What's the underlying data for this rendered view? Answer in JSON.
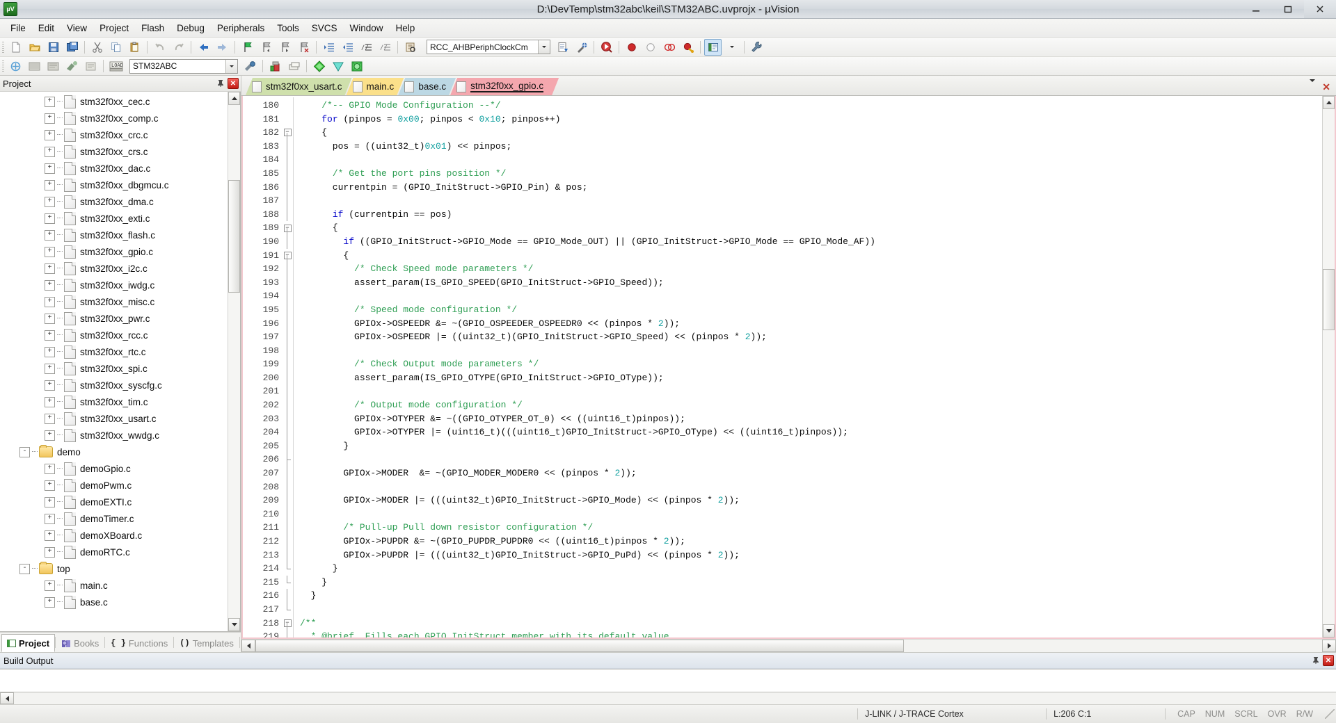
{
  "window": {
    "title": "D:\\DevTemp\\stm32abc\\keil\\STM32ABC.uvprojx - µVision",
    "app_icon": "uvision-icon",
    "minimize": "minimize-button",
    "maximize": "maximize-button",
    "close": "close-button"
  },
  "menu": {
    "items": [
      "File",
      "Edit",
      "View",
      "Project",
      "Flash",
      "Debug",
      "Peripherals",
      "Tools",
      "SVCS",
      "Window",
      "Help"
    ]
  },
  "toolbar1": {
    "icons": [
      "new-file-icon",
      "open-file-icon",
      "save-icon",
      "save-all-icon",
      "cut-icon",
      "copy-icon",
      "paste-icon",
      "undo-icon",
      "redo-icon",
      "navigate-back-icon",
      "navigate-forward-icon",
      "bookmark-toggle-icon",
      "bookmark-prev-icon",
      "bookmark-next-icon",
      "bookmark-clear-icon",
      "indent-right-icon",
      "indent-left-icon",
      "comment-lines-icon",
      "uncomment-lines-icon",
      "find-in-files-icon"
    ],
    "symbol_combo_value": "RCC_AHBPeriphClockCm",
    "after_combo_icons": [
      "insert-template-icon",
      "configuration-wizard-icon",
      "start-debug-icon",
      "breakpoint-icon",
      "breakpoint-disable-icon",
      "breakpoints-kill-all-icon",
      "breakpoint-enable-icon",
      "project-window-icon",
      "project-window-dropdown-icon",
      "options-wrench-icon"
    ]
  },
  "toolbar2": {
    "icons": [
      "translate-file-icon",
      "build-target-icon",
      "rebuild-all-icon",
      "batch-build-icon",
      "stop-build-icon",
      "download-icon"
    ],
    "target_combo_value": "STM32ABC",
    "after_icons": [
      "target-options-icon",
      "manage-project-items-icon",
      "manage-multi-project-icon",
      "pack-installer-icon",
      "manage-run-time-env-icon",
      "software-packs-icon"
    ]
  },
  "project_pane": {
    "title": "Project",
    "pin_icon": "pin-icon",
    "close_icon": "close-icon",
    "tree": [
      {
        "label": "stm32f0xx_cec.c",
        "type": "file",
        "depth": 2,
        "expander": "+"
      },
      {
        "label": "stm32f0xx_comp.c",
        "type": "file",
        "depth": 2,
        "expander": "+"
      },
      {
        "label": "stm32f0xx_crc.c",
        "type": "file",
        "depth": 2,
        "expander": "+"
      },
      {
        "label": "stm32f0xx_crs.c",
        "type": "file",
        "depth": 2,
        "expander": "+"
      },
      {
        "label": "stm32f0xx_dac.c",
        "type": "file",
        "depth": 2,
        "expander": "+"
      },
      {
        "label": "stm32f0xx_dbgmcu.c",
        "type": "file",
        "depth": 2,
        "expander": "+"
      },
      {
        "label": "stm32f0xx_dma.c",
        "type": "file",
        "depth": 2,
        "expander": "+"
      },
      {
        "label": "stm32f0xx_exti.c",
        "type": "file",
        "depth": 2,
        "expander": "+"
      },
      {
        "label": "stm32f0xx_flash.c",
        "type": "file",
        "depth": 2,
        "expander": "+"
      },
      {
        "label": "stm32f0xx_gpio.c",
        "type": "file",
        "depth": 2,
        "expander": "+"
      },
      {
        "label": "stm32f0xx_i2c.c",
        "type": "file",
        "depth": 2,
        "expander": "+"
      },
      {
        "label": "stm32f0xx_iwdg.c",
        "type": "file",
        "depth": 2,
        "expander": "+"
      },
      {
        "label": "stm32f0xx_misc.c",
        "type": "file",
        "depth": 2,
        "expander": "+"
      },
      {
        "label": "stm32f0xx_pwr.c",
        "type": "file",
        "depth": 2,
        "expander": "+"
      },
      {
        "label": "stm32f0xx_rcc.c",
        "type": "file",
        "depth": 2,
        "expander": "+"
      },
      {
        "label": "stm32f0xx_rtc.c",
        "type": "file",
        "depth": 2,
        "expander": "+"
      },
      {
        "label": "stm32f0xx_spi.c",
        "type": "file",
        "depth": 2,
        "expander": "+"
      },
      {
        "label": "stm32f0xx_syscfg.c",
        "type": "file",
        "depth": 2,
        "expander": "+"
      },
      {
        "label": "stm32f0xx_tim.c",
        "type": "file",
        "depth": 2,
        "expander": "+"
      },
      {
        "label": "stm32f0xx_usart.c",
        "type": "file",
        "depth": 2,
        "expander": "+"
      },
      {
        "label": "stm32f0xx_wwdg.c",
        "type": "file",
        "depth": 2,
        "expander": "+"
      },
      {
        "label": "demo",
        "type": "folder",
        "depth": 1,
        "expander": "-"
      },
      {
        "label": "demoGpio.c",
        "type": "file",
        "depth": 2,
        "expander": "+"
      },
      {
        "label": "demoPwm.c",
        "type": "file",
        "depth": 2,
        "expander": "+"
      },
      {
        "label": "demoEXTI.c",
        "type": "file",
        "depth": 2,
        "expander": "+"
      },
      {
        "label": "demoTimer.c",
        "type": "file",
        "depth": 2,
        "expander": "+"
      },
      {
        "label": "demoXBoard.c",
        "type": "file",
        "depth": 2,
        "expander": "+"
      },
      {
        "label": "demoRTC.c",
        "type": "file",
        "depth": 2,
        "expander": "+"
      },
      {
        "label": "top",
        "type": "folder",
        "depth": 1,
        "expander": "-"
      },
      {
        "label": "main.c",
        "type": "file",
        "depth": 2,
        "expander": "+"
      },
      {
        "label": "base.c",
        "type": "file",
        "depth": 2,
        "expander": "+"
      }
    ],
    "bottom_tabs": [
      {
        "label": "Project",
        "icon": "project-icon",
        "selected": true
      },
      {
        "label": "Books",
        "icon": "books-icon",
        "selected": false
      },
      {
        "label": "Functions",
        "icon": "functions-icon",
        "selected": false
      },
      {
        "label": "Templates",
        "icon": "templates-icon",
        "selected": false
      }
    ]
  },
  "editor": {
    "tabs": [
      {
        "label": "stm32f0xx_usart.c",
        "active": false,
        "color": "#cfe0ac"
      },
      {
        "label": "main.c",
        "active": false,
        "color": "#fbe08a"
      },
      {
        "label": "base.c",
        "active": false,
        "color": "#bcd8e4"
      },
      {
        "label": "stm32f0xx_gpio.c",
        "active": true,
        "color": "#f4a7ae"
      }
    ],
    "tabbar_controls": [
      "tab-list-dropdown-icon",
      "close-document-icon"
    ],
    "first_line_number": 180,
    "lines": [
      {
        "n": 180,
        "fold": "",
        "segs": [
          {
            "t": "    ",
            "c": ""
          },
          {
            "t": "/*-- GPIO Mode Configuration --*/",
            "c": "cmt"
          }
        ]
      },
      {
        "n": 181,
        "fold": "",
        "segs": [
          {
            "t": "    ",
            "c": ""
          },
          {
            "t": "for",
            "c": "kw"
          },
          {
            "t": " (pinpos = ",
            "c": ""
          },
          {
            "t": "0x00",
            "c": "num"
          },
          {
            "t": "; pinpos < ",
            "c": ""
          },
          {
            "t": "0x10",
            "c": "num"
          },
          {
            "t": "; pinpos++)",
            "c": ""
          }
        ]
      },
      {
        "n": 182,
        "fold": "box-minus-start",
        "segs": [
          {
            "t": "    {",
            "c": ""
          }
        ]
      },
      {
        "n": 183,
        "fold": "bar",
        "segs": [
          {
            "t": "      pos = ((uint32_t)",
            "c": ""
          },
          {
            "t": "0x01",
            "c": "num"
          },
          {
            "t": ") << pinpos;",
            "c": ""
          }
        ]
      },
      {
        "n": 184,
        "fold": "bar",
        "segs": [
          {
            "t": "",
            "c": ""
          }
        ]
      },
      {
        "n": 185,
        "fold": "bar",
        "segs": [
          {
            "t": "      ",
            "c": ""
          },
          {
            "t": "/* Get the port pins position */",
            "c": "cmt"
          }
        ]
      },
      {
        "n": 186,
        "fold": "bar",
        "segs": [
          {
            "t": "      currentpin = (GPIO_InitStruct->GPIO_Pin) & pos;",
            "c": ""
          }
        ]
      },
      {
        "n": 187,
        "fold": "bar",
        "segs": [
          {
            "t": "",
            "c": ""
          }
        ]
      },
      {
        "n": 188,
        "fold": "bar",
        "segs": [
          {
            "t": "      ",
            "c": ""
          },
          {
            "t": "if",
            "c": "kw"
          },
          {
            "t": " (currentpin == pos)",
            "c": ""
          }
        ]
      },
      {
        "n": 189,
        "fold": "box-minus",
        "segs": [
          {
            "t": "      {",
            "c": ""
          }
        ]
      },
      {
        "n": 190,
        "fold": "bar",
        "segs": [
          {
            "t": "        ",
            "c": ""
          },
          {
            "t": "if",
            "c": "kw"
          },
          {
            "t": " ((GPIO_InitStruct->GPIO_Mode == GPIO_Mode_OUT) || (GPIO_InitStruct->GPIO_Mode == GPIO_Mode_AF))",
            "c": ""
          }
        ]
      },
      {
        "n": 191,
        "fold": "box-minus",
        "segs": [
          {
            "t": "        {",
            "c": ""
          }
        ]
      },
      {
        "n": 192,
        "fold": "bar",
        "segs": [
          {
            "t": "          ",
            "c": ""
          },
          {
            "t": "/* Check Speed mode parameters */",
            "c": "cmt"
          }
        ]
      },
      {
        "n": 193,
        "fold": "bar",
        "segs": [
          {
            "t": "          assert_param(IS_GPIO_SPEED(GPIO_InitStruct->GPIO_Speed));",
            "c": ""
          }
        ]
      },
      {
        "n": 194,
        "fold": "bar",
        "segs": [
          {
            "t": "",
            "c": ""
          }
        ]
      },
      {
        "n": 195,
        "fold": "bar",
        "segs": [
          {
            "t": "          ",
            "c": ""
          },
          {
            "t": "/* Speed mode configuration */",
            "c": "cmt"
          }
        ]
      },
      {
        "n": 196,
        "fold": "bar",
        "segs": [
          {
            "t": "          GPIOx->OSPEEDR &= ~(GPIO_OSPEEDER_OSPEEDR0 << (pinpos * ",
            "c": ""
          },
          {
            "t": "2",
            "c": "num"
          },
          {
            "t": "));",
            "c": ""
          }
        ]
      },
      {
        "n": 197,
        "fold": "bar",
        "segs": [
          {
            "t": "          GPIOx->OSPEEDR |= ((uint32_t)(GPIO_InitStruct->GPIO_Speed) << (pinpos * ",
            "c": ""
          },
          {
            "t": "2",
            "c": "num"
          },
          {
            "t": "));",
            "c": ""
          }
        ]
      },
      {
        "n": 198,
        "fold": "bar",
        "segs": [
          {
            "t": "",
            "c": ""
          }
        ]
      },
      {
        "n": 199,
        "fold": "bar",
        "segs": [
          {
            "t": "          ",
            "c": ""
          },
          {
            "t": "/* Check Output mode parameters */",
            "c": "cmt"
          }
        ]
      },
      {
        "n": 200,
        "fold": "bar",
        "segs": [
          {
            "t": "          assert_param(IS_GPIO_OTYPE(GPIO_InitStruct->GPIO_OType));",
            "c": ""
          }
        ]
      },
      {
        "n": 201,
        "fold": "bar",
        "segs": [
          {
            "t": "",
            "c": ""
          }
        ]
      },
      {
        "n": 202,
        "fold": "bar",
        "segs": [
          {
            "t": "          ",
            "c": ""
          },
          {
            "t": "/* Output mode configuration */",
            "c": "cmt"
          }
        ]
      },
      {
        "n": 203,
        "fold": "bar",
        "segs": [
          {
            "t": "          GPIOx->OTYPER &= ~((GPIO_OTYPER_OT_0) << ((uint16_t)pinpos));",
            "c": ""
          }
        ]
      },
      {
        "n": 204,
        "fold": "bar",
        "segs": [
          {
            "t": "          GPIOx->OTYPER |= (uint16_t)(((uint16_t)GPIO_InitStruct->GPIO_OType) << ((uint16_t)pinpos));",
            "c": ""
          }
        ]
      },
      {
        "n": 205,
        "fold": "bar",
        "segs": [
          {
            "t": "        }",
            "c": ""
          }
        ]
      },
      {
        "n": 206,
        "fold": "tick",
        "segs": [
          {
            "t": "",
            "c": ""
          }
        ]
      },
      {
        "n": 207,
        "fold": "bar",
        "segs": [
          {
            "t": "        GPIOx->MODER  &= ~(GPIO_MODER_MODER0 << (pinpos * ",
            "c": ""
          },
          {
            "t": "2",
            "c": "num"
          },
          {
            "t": "));",
            "c": ""
          }
        ]
      },
      {
        "n": 208,
        "fold": "bar",
        "segs": [
          {
            "t": "",
            "c": ""
          }
        ]
      },
      {
        "n": 209,
        "fold": "bar",
        "segs": [
          {
            "t": "        GPIOx->MODER |= (((uint32_t)GPIO_InitStruct->GPIO_Mode) << (pinpos * ",
            "c": ""
          },
          {
            "t": "2",
            "c": "num"
          },
          {
            "t": "));",
            "c": ""
          }
        ]
      },
      {
        "n": 210,
        "fold": "bar",
        "segs": [
          {
            "t": "",
            "c": ""
          }
        ]
      },
      {
        "n": 211,
        "fold": "bar",
        "segs": [
          {
            "t": "        ",
            "c": ""
          },
          {
            "t": "/* Pull-up Pull down resistor configuration */",
            "c": "cmt"
          }
        ]
      },
      {
        "n": 212,
        "fold": "bar",
        "segs": [
          {
            "t": "        GPIOx->PUPDR &= ~(GPIO_PUPDR_PUPDR0 << ((uint16_t)pinpos * ",
            "c": ""
          },
          {
            "t": "2",
            "c": "num"
          },
          {
            "t": "));",
            "c": ""
          }
        ]
      },
      {
        "n": 213,
        "fold": "bar",
        "segs": [
          {
            "t": "        GPIOx->PUPDR |= (((uint32_t)GPIO_InitStruct->GPIO_PuPd) << (pinpos * ",
            "c": ""
          },
          {
            "t": "2",
            "c": "num"
          },
          {
            "t": "));",
            "c": ""
          }
        ]
      },
      {
        "n": 214,
        "fold": "end",
        "segs": [
          {
            "t": "      }",
            "c": ""
          }
        ]
      },
      {
        "n": 215,
        "fold": "end",
        "segs": [
          {
            "t": "    }",
            "c": ""
          }
        ]
      },
      {
        "n": 216,
        "fold": "bar",
        "segs": [
          {
            "t": "  }",
            "c": ""
          }
        ]
      },
      {
        "n": 217,
        "fold": "end",
        "segs": [
          {
            "t": "",
            "c": ""
          }
        ]
      },
      {
        "n": 218,
        "fold": "box-minus-start",
        "segs": [
          {
            "t": "/**",
            "c": "cmt"
          }
        ]
      },
      {
        "n": 219,
        "fold": "bar",
        "segs": [
          {
            "t": "  ",
            "c": ""
          },
          {
            "t": "* @brief  Fills each GPIO_InitStruct member with its default value.",
            "c": "cmt"
          }
        ]
      }
    ]
  },
  "build_output": {
    "title": "Build Output",
    "pin_icon": "pin-icon",
    "close_icon": "close-icon",
    "text": ""
  },
  "statusbar": {
    "debugger": "J-LINK / J-TRACE Cortex",
    "cursor": "L:206 C:1",
    "indicators": [
      "CAP",
      "NUM",
      "SCRL",
      "OVR",
      "R/W"
    ]
  },
  "colors": {
    "comment": "#2e9e53",
    "keyword": "#0000c8",
    "number": "#12a0a0",
    "active_tab": "#f4a7ae",
    "accent": "#f3c9cf"
  }
}
